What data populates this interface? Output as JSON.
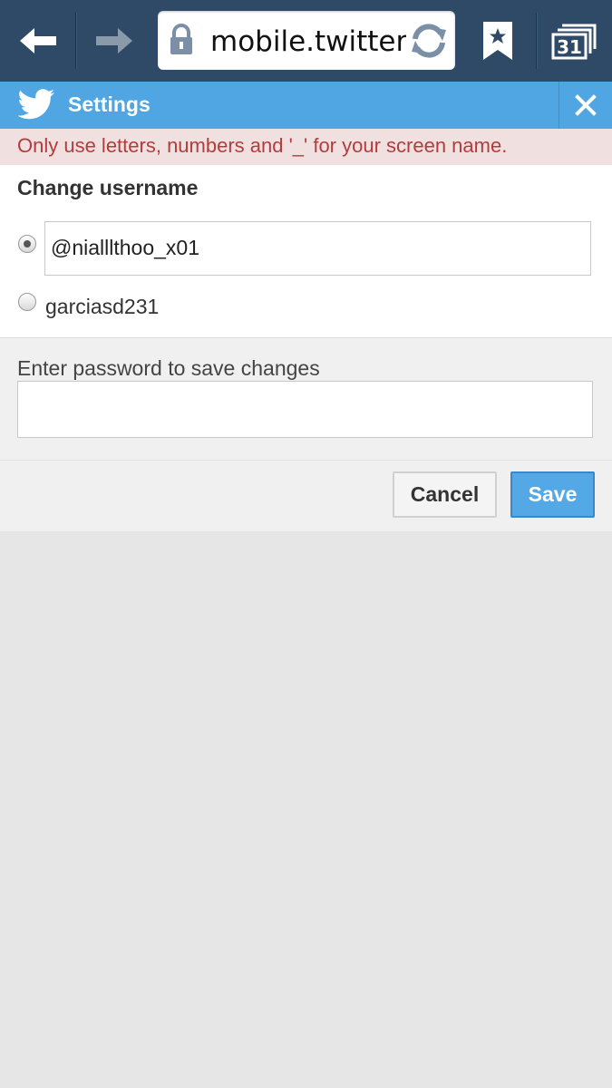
{
  "browser": {
    "url": "mobile.twitter.com",
    "back_icon": "arrow-left-icon",
    "forward_icon": "arrow-right-icon",
    "lock_icon": "lock-icon",
    "refresh_icon": "refresh-icon",
    "bookmark_icon": "bookmark-star-icon",
    "tabs_icon": "tabs-icon",
    "tabs_count": "31"
  },
  "header": {
    "title": "Settings",
    "logo_icon": "twitter-bird-icon",
    "close_icon": "close-icon"
  },
  "error": {
    "message": "Only use letters, numbers and '_' for your screen name."
  },
  "username": {
    "section_title": "Change username",
    "options": [
      {
        "value": "@nialllthoo_x01",
        "checked": true
      },
      {
        "value": "garciasd231",
        "checked": false
      }
    ]
  },
  "password": {
    "label": "Enter password to save changes",
    "value": ""
  },
  "actions": {
    "cancel_label": "Cancel",
    "save_label": "Save"
  },
  "colors": {
    "browser_bar": "#2e4a66",
    "twitter_blue": "#4fa6e3",
    "error_text": "#b43c3c",
    "error_bg": "#f1e0e0"
  }
}
